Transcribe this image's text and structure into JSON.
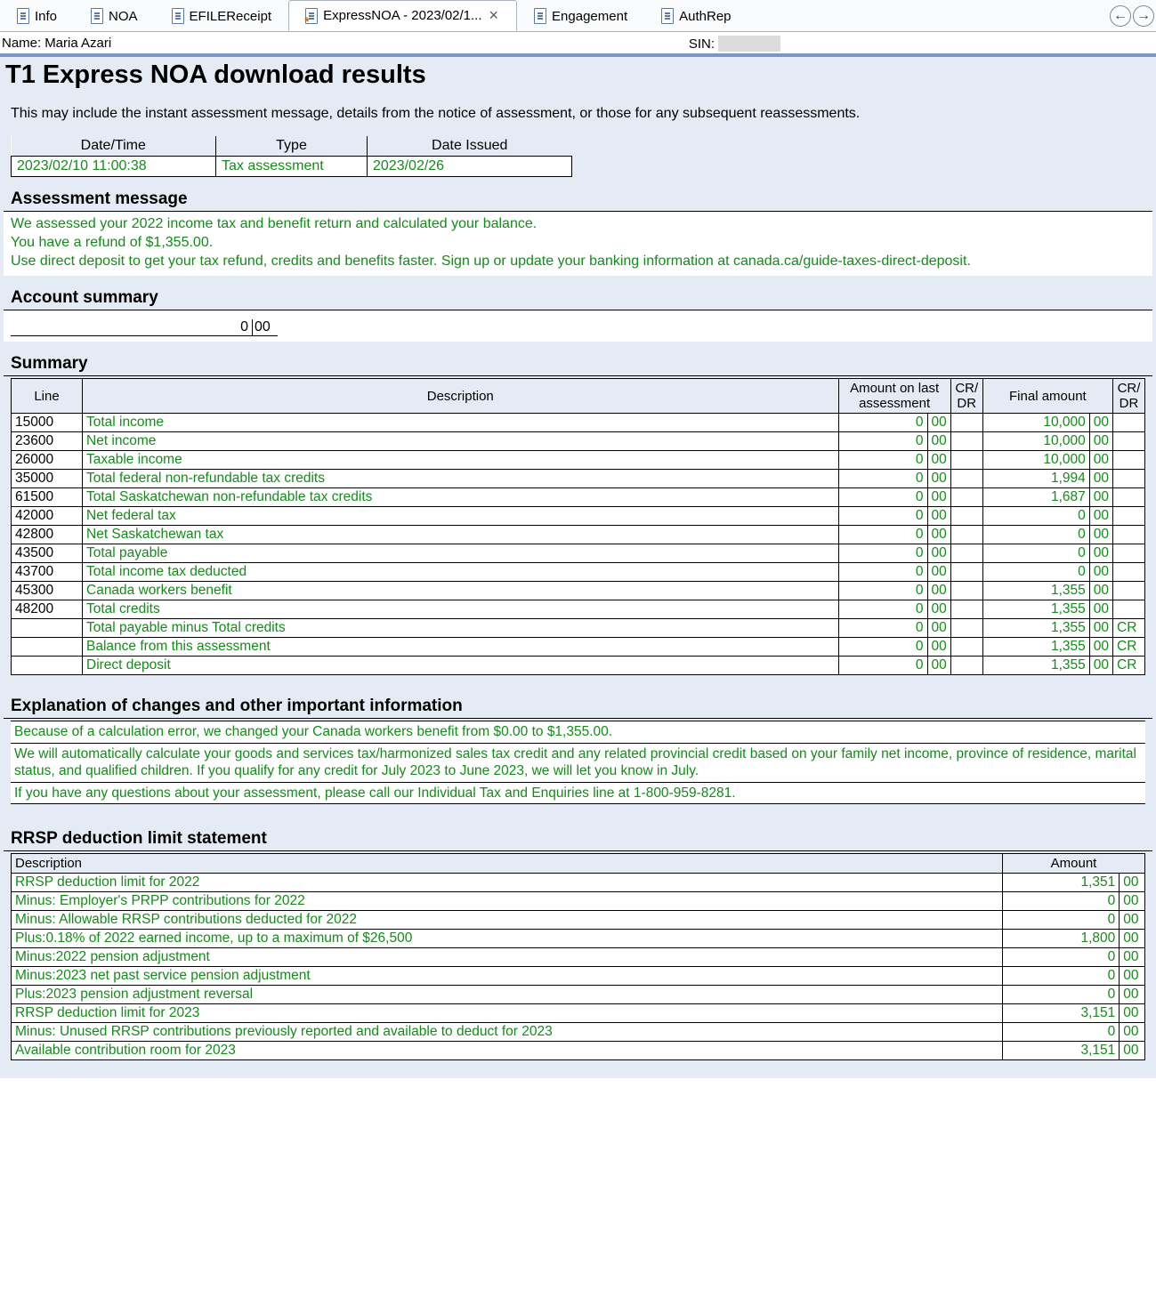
{
  "tabs": {
    "items": [
      {
        "label": "Info"
      },
      {
        "label": "NOA"
      },
      {
        "label": "EFILEReceipt"
      },
      {
        "label": "ExpressNOA - 2023/02/1...",
        "active": true
      },
      {
        "label": "Engagement"
      },
      {
        "label": "AuthRep"
      }
    ]
  },
  "id": {
    "name_label": "Name:",
    "name_value": "Maria Azari",
    "sin_label": "SIN:"
  },
  "title": "T1 Express NOA download results",
  "intro": "This may include the instant assessment message, details from the notice of assessment, or those for any subsequent reassessments.",
  "meta": {
    "headers": {
      "dt": "Date/Time",
      "ty": "Type",
      "di": "Date Issued"
    },
    "row": {
      "dt": "2023/02/10 11:00:38",
      "ty": "Tax assessment",
      "di": "2023/02/26"
    }
  },
  "assessment": {
    "heading": "Assessment message",
    "line1": "We assessed your 2022 income tax and benefit return and calculated your balance.",
    "line2": "You have a refund of $1,355.00.",
    "line3": "Use direct deposit to get your tax refund, credits and benefits faster. Sign up or update your banking information at canada.ca/guide-taxes-direct-deposit."
  },
  "account_summary": {
    "heading": "Account summary",
    "int": "0",
    "dec": "00"
  },
  "summary": {
    "heading": "Summary",
    "headers": {
      "line": "Line",
      "desc": "Description",
      "last": "Amount on last assessment",
      "crdr1": "CR/ DR",
      "final": "Final amount",
      "crdr2": "CR/ DR"
    },
    "rows": [
      {
        "line": "15000",
        "desc": "Total income",
        "li": "0",
        "ld": "00",
        "fi": "10,000",
        "fd": "00",
        "cr": ""
      },
      {
        "line": "23600",
        "desc": "Net income",
        "li": "0",
        "ld": "00",
        "fi": "10,000",
        "fd": "00",
        "cr": ""
      },
      {
        "line": "26000",
        "desc": "Taxable income",
        "li": "0",
        "ld": "00",
        "fi": "10,000",
        "fd": "00",
        "cr": ""
      },
      {
        "line": "35000",
        "desc": "Total federal non-refundable tax credits",
        "li": "0",
        "ld": "00",
        "fi": "1,994",
        "fd": "00",
        "cr": ""
      },
      {
        "line": "61500",
        "desc": "Total Saskatchewan non-refundable tax credits",
        "li": "0",
        "ld": "00",
        "fi": "1,687",
        "fd": "00",
        "cr": ""
      },
      {
        "line": "42000",
        "desc": "Net federal tax",
        "li": "0",
        "ld": "00",
        "fi": "0",
        "fd": "00",
        "cr": ""
      },
      {
        "line": "42800",
        "desc": "Net Saskatchewan tax",
        "li": "0",
        "ld": "00",
        "fi": "0",
        "fd": "00",
        "cr": ""
      },
      {
        "line": "43500",
        "desc": "Total payable",
        "li": "0",
        "ld": "00",
        "fi": "0",
        "fd": "00",
        "cr": ""
      },
      {
        "line": "43700",
        "desc": "Total income tax deducted",
        "li": "0",
        "ld": "00",
        "fi": "0",
        "fd": "00",
        "cr": ""
      },
      {
        "line": "45300",
        "desc": "Canada workers benefit",
        "li": "0",
        "ld": "00",
        "fi": "1,355",
        "fd": "00",
        "cr": ""
      },
      {
        "line": "48200",
        "desc": "Total credits",
        "li": "0",
        "ld": "00",
        "fi": "1,355",
        "fd": "00",
        "cr": ""
      },
      {
        "line": "",
        "desc": "Total payable minus Total credits",
        "li": "0",
        "ld": "00",
        "fi": "1,355",
        "fd": "00",
        "cr": "CR"
      },
      {
        "line": "",
        "desc": "Balance from this assessment",
        "li": "0",
        "ld": "00",
        "fi": "1,355",
        "fd": "00",
        "cr": "CR"
      },
      {
        "line": "",
        "desc": "Direct deposit",
        "li": "0",
        "ld": "00",
        "fi": "1,355",
        "fd": "00",
        "cr": "CR"
      }
    ]
  },
  "explain": {
    "heading": "Explanation of changes and other important information",
    "p1": "Because of a calculation error, we changed your Canada workers benefit from $0.00 to $1,355.00.",
    "p2": "We will automatically calculate your goods and services tax/harmonized sales tax credit and any related provincial credit based on your family net income, province of residence, marital status, and qualified children. If you qualify for any credit for July 2023 to June 2023, we will let you know in July.",
    "p3": "If you have any questions about your assessment, please call our Individual Tax and Enquiries line at 1-800-959-8281."
  },
  "rrsp": {
    "heading": "RRSP deduction limit statement",
    "headers": {
      "desc": "Description",
      "amt": "Amount"
    },
    "rows": [
      {
        "desc": "RRSP deduction limit for 2022",
        "i": "1,351",
        "d": "00"
      },
      {
        "desc": "Minus: Employer's PRPP contributions for 2022",
        "i": "0",
        "d": "00"
      },
      {
        "desc": "Minus: Allowable RRSP contributions deducted for 2022",
        "i": "0",
        "d": "00"
      },
      {
        "desc": "Plus:0.18% of 2022 earned income, up to a maximum of $26,500",
        "i": "1,800",
        "d": "00"
      },
      {
        "desc": "Minus:2022 pension adjustment",
        "i": "0",
        "d": "00"
      },
      {
        "desc": "Minus:2023 net past service pension adjustment",
        "i": "0",
        "d": "00"
      },
      {
        "desc": "Plus:2023 pension adjustment reversal",
        "i": "0",
        "d": "00"
      },
      {
        "desc": "RRSP deduction limit for 2023",
        "i": "3,151",
        "d": "00"
      },
      {
        "desc": "Minus: Unused RRSP contributions previously reported and available to deduct for 2023",
        "i": "0",
        "d": "00"
      },
      {
        "desc": "Available contribution room for 2023",
        "i": "3,151",
        "d": "00"
      }
    ]
  }
}
